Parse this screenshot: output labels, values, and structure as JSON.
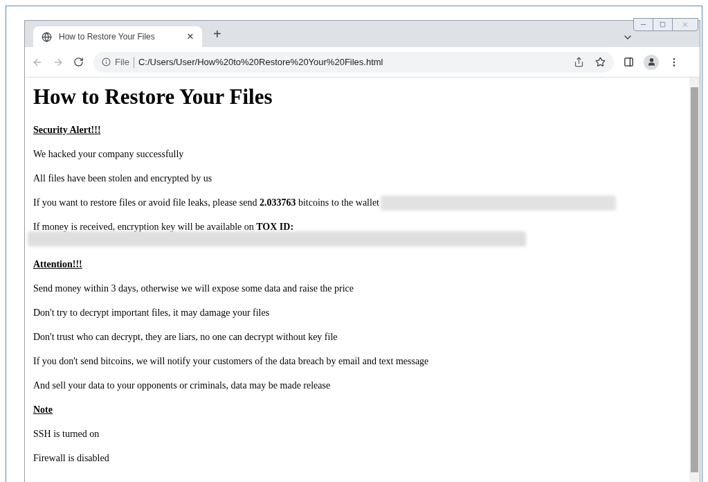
{
  "browser": {
    "tab": {
      "title": "How to Restore Your Files",
      "close": "×",
      "new_tab": "+"
    },
    "address": {
      "scheme": "File",
      "url": "C:/Users/User/How%20to%20Restore%20Your%20Files.html"
    }
  },
  "page": {
    "title": "How to Restore Your Files",
    "blocks": [
      {
        "kind": "heading",
        "text": "Security Alert!!!"
      },
      {
        "kind": "text",
        "text": "We hacked your company successfully"
      },
      {
        "kind": "text",
        "text": "All files have been stolen and encrypted by us"
      },
      {
        "kind": "text_redacted",
        "text": "If you want to restore files or avoid file leaks, please send **2.033763** bitcoins to the wallet"
      },
      {
        "kind": "text",
        "text": "If money is received, encryption key will be available on **TOX ID:**"
      },
      {
        "kind": "redacted"
      },
      {
        "kind": "heading",
        "text": "Attention!!!"
      },
      {
        "kind": "text",
        "text": "Send money within 3 days, otherwise we will expose some data and raise the price"
      },
      {
        "kind": "text",
        "text": "Don't try to decrypt important files, it may damage your files"
      },
      {
        "kind": "text",
        "text": "Don't trust who can decrypt, they are liars, no one can decrypt without key file"
      },
      {
        "kind": "text",
        "text": "If you don't send bitcoins, we will notify your customers of the data breach by email and text message"
      },
      {
        "kind": "text",
        "text": "And sell your data to your opponents or criminals, data may be made release"
      },
      {
        "kind": "heading",
        "text": "Note"
      },
      {
        "kind": "text",
        "text": "SSH is turned on"
      },
      {
        "kind": "text",
        "text": "Firewall is disabled"
      }
    ]
  }
}
